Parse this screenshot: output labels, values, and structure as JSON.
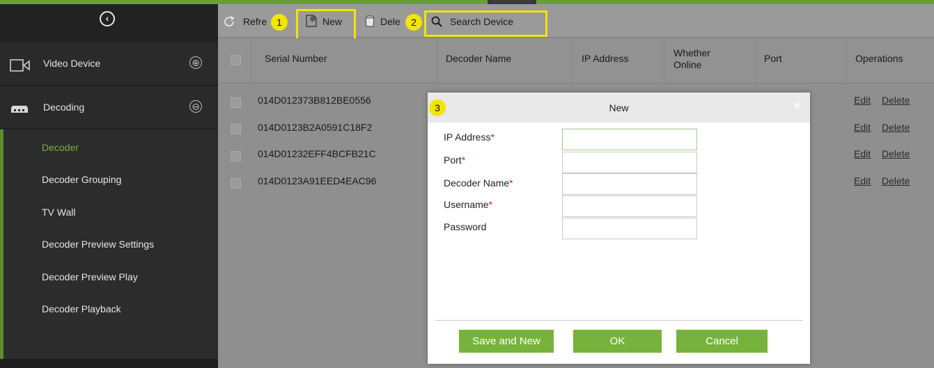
{
  "sidebar": {
    "collapse_icon": "collapse-circle-icon",
    "groups": [
      {
        "label": "Video Device",
        "icon": "video-camera-icon",
        "toggle": "⊕"
      },
      {
        "label": "Decoding",
        "icon": "decoder-device-icon",
        "toggle": "⊖"
      }
    ],
    "items": [
      {
        "label": "Decoder",
        "active": true
      },
      {
        "label": "Decoder Grouping"
      },
      {
        "label": "TV Wall"
      },
      {
        "label": "Decoder Preview Settings"
      },
      {
        "label": "Decoder Preview Play"
      },
      {
        "label": "Decoder Playback"
      }
    ]
  },
  "toolbar": {
    "refresh_label": "Refre",
    "new_label": "New",
    "delete_label": "Dele",
    "search_label": "Search Device",
    "badges": [
      "1",
      "2",
      "3"
    ],
    "highlight_color": "#f2e500"
  },
  "table": {
    "headers": [
      "Serial Number",
      "Decoder Name",
      "IP Address",
      "Whether Online",
      "Port",
      "Operations"
    ],
    "rows": [
      {
        "serial": "014D012373B812BE0556"
      },
      {
        "serial": "014D0123B2A0591C18F2"
      },
      {
        "serial": "014D01232EFF4BCFB21C"
      },
      {
        "serial": "014D0123A91EED4EAC96"
      }
    ],
    "edit_label": "Edit",
    "delete_label": "Delete"
  },
  "modal": {
    "title": "New",
    "close": "×",
    "fields": [
      {
        "label": "IP Address",
        "required": "*",
        "value": ""
      },
      {
        "label": "Port",
        "required": "*",
        "value": ""
      },
      {
        "label": "Decoder Name",
        "required": "*",
        "value": ""
      },
      {
        "label": "Username",
        "required": "*",
        "value": ""
      },
      {
        "label": "Password",
        "required": "",
        "value": ""
      }
    ],
    "buttons": {
      "save_new": "Save and New",
      "ok": "OK",
      "cancel": "Cancel"
    }
  },
  "colors": {
    "accent": "#77b33c",
    "active_menu": "#79b13c",
    "required": "#d21f1f"
  }
}
